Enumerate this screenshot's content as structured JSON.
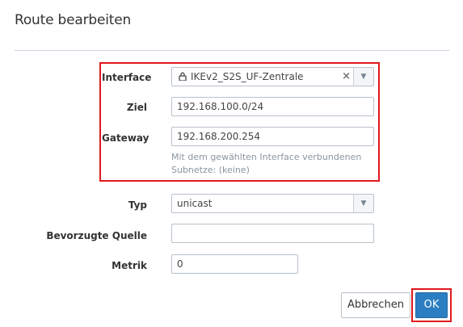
{
  "dialog": {
    "title": "Route bearbeiten"
  },
  "form": {
    "interface": {
      "label": "Interface",
      "value": "IKEv2_S2S_UF-Zentrale",
      "icon": "lock-icon"
    },
    "ziel": {
      "label": "Ziel",
      "value": "192.168.100.0/24"
    },
    "gateway": {
      "label": "Gateway",
      "value": "192.168.200.254",
      "hint_line1": "Mit dem gewählten Interface verbundenen",
      "hint_line2": "Subnetze: (keine)"
    },
    "typ": {
      "label": "Typ",
      "value": "unicast"
    },
    "bevorzugte_quelle": {
      "label": "Bevorzugte Quelle",
      "value": ""
    },
    "metrik": {
      "label": "Metrik",
      "value": "0"
    }
  },
  "buttons": {
    "cancel_label": "Abbrechen",
    "ok_label": "OK"
  },
  "colors": {
    "highlight": "#e0191e",
    "primary": "#2b7ec1"
  }
}
